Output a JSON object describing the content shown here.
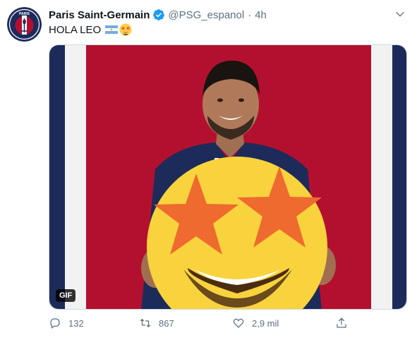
{
  "tweet": {
    "display_name": "Paris Saint-Germain",
    "handle": "@PSG_espanol",
    "separator": "·",
    "time": "4h",
    "text": "HOLA LEO",
    "text_emojis": [
      "argentina-flag-icon",
      "star-struck-emoji"
    ],
    "avatar_label": "PARIS",
    "media": {
      "badge": "GIF"
    },
    "actions": {
      "reply_count": "132",
      "retweet_count": "867",
      "like_count": "2,9 mil"
    }
  },
  "colors": {
    "psg_navy": "#1c2b5a",
    "psg_red": "#b3102f",
    "verified_blue": "#1d9bf0",
    "muted_text": "#5b7083"
  }
}
